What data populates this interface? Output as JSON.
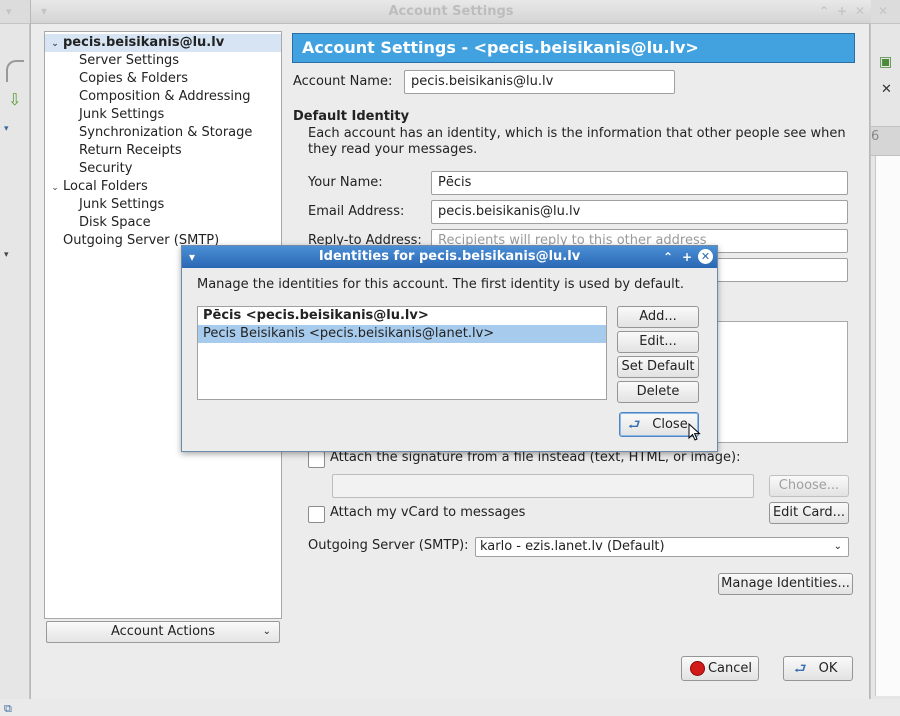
{
  "window": {
    "title": "Account Settings"
  },
  "tree": {
    "items": [
      {
        "label": "pecis.beisikanis@lu.lv",
        "level": 0,
        "expanded": true,
        "selected": true
      },
      {
        "label": "Server Settings",
        "level": 1
      },
      {
        "label": "Copies & Folders",
        "level": 1
      },
      {
        "label": "Composition & Addressing",
        "level": 1
      },
      {
        "label": "Junk Settings",
        "level": 1
      },
      {
        "label": "Synchronization & Storage",
        "level": 1
      },
      {
        "label": "Return Receipts",
        "level": 1
      },
      {
        "label": "Security",
        "level": 1
      },
      {
        "label": "Local Folders",
        "level": 0,
        "expanded": true
      },
      {
        "label": "Junk Settings",
        "level": 1
      },
      {
        "label": "Disk Space",
        "level": 1
      },
      {
        "label": "Outgoing Server (SMTP)",
        "level": 0
      }
    ],
    "account_actions_label": "Account Actions"
  },
  "panel": {
    "header": "Account Settings - <pecis.beisikanis@lu.lv>",
    "account_name_label": "Account Name:",
    "account_name_value": "pecis.beisikanis@lu.lv",
    "default_identity_title": "Default Identity",
    "default_identity_desc": "Each account has an identity, which is the information that other people see when they read your messages.",
    "your_name_label": "Your Name:",
    "your_name_value": "Pēcis",
    "email_label": "Email Address:",
    "email_value": "pecis.beisikanis@lu.lv",
    "reply_to_label": "Reply-to Address:",
    "reply_to_placeholder": "Recipients will reply to this other address",
    "attach_sig_label": "Attach the signature from a file instead (text, HTML, or image):",
    "choose_label": "Choose...",
    "attach_vcard_label": "Attach my vCard to messages",
    "edit_card_label": "Edit Card...",
    "outgoing_label": "Outgoing Server (SMTP):",
    "outgoing_value": "karlo - ezis.lanet.lv (Default)",
    "manage_identities_label": "Manage Identities...",
    "cancel_label": "Cancel",
    "ok_label": "OK"
  },
  "dialog": {
    "title": "Identities for pecis.beisikanis@lu.lv",
    "description": "Manage the identities for this account. The first identity is used by default.",
    "identities": [
      {
        "label": "Pēcis <pecis.beisikanis@lu.lv>",
        "default": true
      },
      {
        "label": "Pecis Beisikanis <pecis.beisikanis@lanet.lv>",
        "selected": true
      }
    ],
    "add_label": "Add...",
    "edit_label": "Edit...",
    "set_default_label": "Set Default",
    "delete_label": "Delete",
    "close_label": "Close"
  },
  "background": {
    "right_glyph": "6"
  }
}
